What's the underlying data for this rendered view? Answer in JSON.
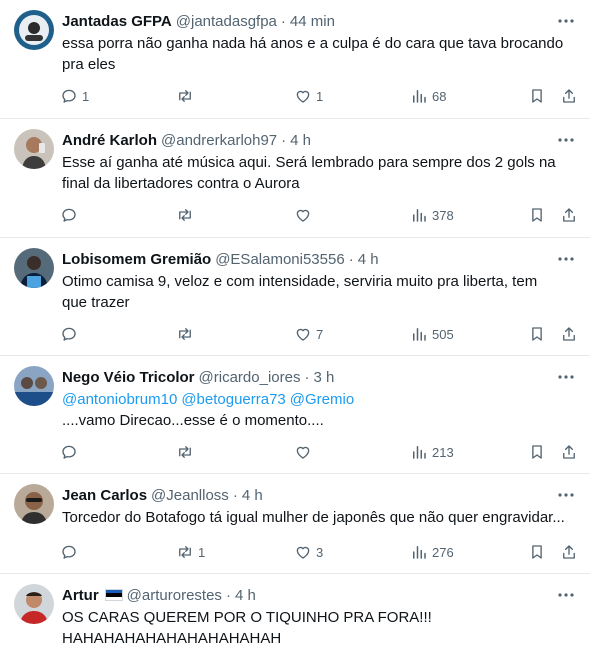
{
  "colors": {
    "text": "#0f1419",
    "muted": "#536471",
    "link": "#1d9bf0",
    "divider": "#e6e9ec"
  },
  "tweets": [
    {
      "user": "Jantadas GFPA",
      "handle": "@jantadasgfpa",
      "separator": "·",
      "time": "44 min",
      "lines": [
        "essa porra não ganha nada há anos e a culpa é do cara que tava brocando",
        "pra eles"
      ],
      "replies": "1",
      "retweets": "",
      "likes": "1",
      "views": "68"
    },
    {
      "user": "André Karloh",
      "handle": "@andrerkarloh97",
      "separator": "·",
      "time": "4 h",
      "lines": [
        "Esse aí ganha até música aqui. Será lembrado para sempre dos 2 gols na",
        "final da libertadores contra o Aurora"
      ],
      "replies": "",
      "retweets": "",
      "likes": "",
      "views": "378"
    },
    {
      "user": "Lobisomem Gremião",
      "handle": "@ESalamoni53556",
      "separator": "·",
      "time": "4 h",
      "lines": [
        "Otimo camisa 9, veloz e com intensidade, serviria muito pra liberta, tem",
        "que trazer"
      ],
      "replies": "",
      "retweets": "",
      "likes": "7",
      "views": "505"
    },
    {
      "user": "Nego Véio Tricolor",
      "handle": "@ricardo_iores",
      "separator": "·",
      "time": "3 h",
      "mentions": [
        "@antoniobrum10",
        "@betoguerra73",
        "@Gremio"
      ],
      "lines": [
        "....vamo Direcao...esse é o momento...."
      ],
      "replies": "",
      "retweets": "",
      "likes": "",
      "views": "213"
    },
    {
      "user": "Jean Carlos",
      "handle": "@Jeanlloss",
      "separator": "·",
      "time": "4 h",
      "lines": [
        "Torcedor do Botafogo tá igual mulher de japonês que não quer engravidar..."
      ],
      "replies": "",
      "retweets": "1",
      "likes": "3",
      "views": "276"
    },
    {
      "user": "Artur",
      "handle": "@arturorestes",
      "separator": "·",
      "time": "4 h",
      "lines": [
        "OS CARAS QUEREM POR O TIQUINHO PRA FORA!!!",
        "HAHAHAHAHAHAHAHAHAHAH"
      ],
      "replies": "",
      "retweets": "",
      "likes": "",
      "views": ""
    }
  ]
}
